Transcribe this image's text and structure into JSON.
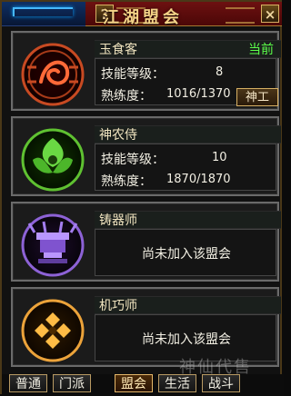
{
  "window": {
    "title": "江湖盟会",
    "help_label": "?",
    "close_label": "×"
  },
  "guilds": [
    {
      "name": "玉食客",
      "status": "当前",
      "skill_label": "技能等级：",
      "skill_value": "8",
      "prof_label": "熟练度：",
      "prof_value": "1016/1370",
      "action_label": "神工",
      "emblem_color": "#d45b2d"
    },
    {
      "name": "神农侍",
      "skill_label": "技能等级：",
      "skill_value": "10",
      "prof_label": "熟练度：",
      "prof_value": "1870/1870",
      "emblem_color": "#67d33a"
    },
    {
      "name": "铸器师",
      "not_joined": "尚未加入该盟会",
      "emblem_color": "#8f63d6"
    },
    {
      "name": "机巧师",
      "not_joined": "尚未加入该盟会",
      "emblem_color": "#f0a92a"
    }
  ],
  "tabs": [
    "普通",
    "门派",
    "盟会",
    "生活",
    "战斗"
  ],
  "active_tab": "盟会",
  "watermark": "神仙代售"
}
